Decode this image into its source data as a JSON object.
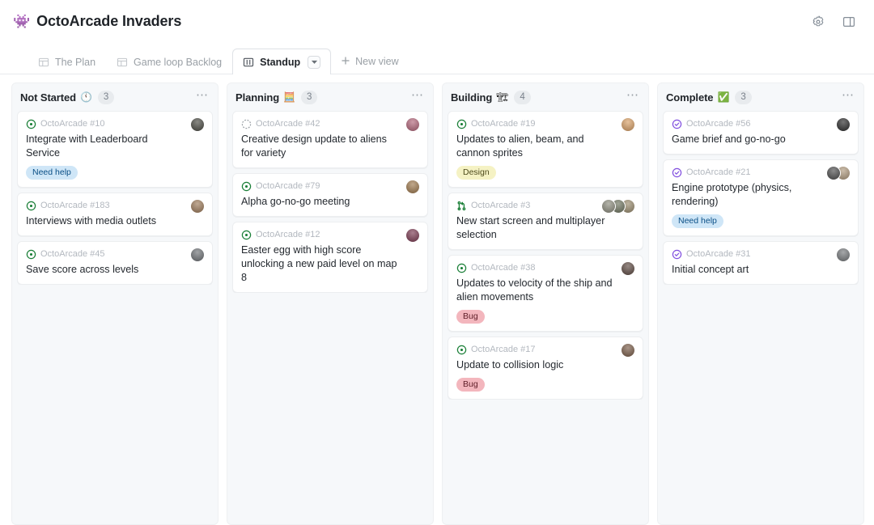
{
  "header": {
    "project_emoji": "👾",
    "title": "OctoArcade Invaders",
    "settings_icon": "gear-icon",
    "panel_icon": "side-panel-icon"
  },
  "tabs": [
    {
      "label": "The Plan",
      "icon": "table-icon",
      "active": false
    },
    {
      "label": "Game loop Backlog",
      "icon": "table-icon",
      "active": false
    },
    {
      "label": "Standup",
      "icon": "board-icon",
      "active": true
    }
  ],
  "new_view": {
    "label": "New view",
    "icon": "plus-icon"
  },
  "add_column": {
    "icon": "plus-icon"
  },
  "colors": {
    "need_help_bg": "#cfe6f7",
    "need_help_fg": "#0a4f86",
    "design_bg": "#f5f2c4",
    "design_fg": "#4e4b1c",
    "bug_bg": "#f3b6bd",
    "bug_fg": "#5e1e28",
    "open_issue": "#1a7f37",
    "closed_issue": "#8250df",
    "draft_issue": "#9aa0a6",
    "open_pr": "#1a7f37",
    "column_bg": "#f6f8fa"
  },
  "columns": [
    {
      "name": "Not Started",
      "emoji": "🕚",
      "count": "3",
      "more_icon": "kebab-icon",
      "cards": [
        {
          "ref": "OctoArcade #10",
          "state": "open-issue",
          "title": "Integrate with Leaderboard Service",
          "labels": [
            {
              "text": "Need help",
              "style": "need_help"
            }
          ],
          "avatars": [
            "#4a4a42"
          ]
        },
        {
          "ref": "OctoArcade #183",
          "state": "open-issue",
          "title": "Interviews with media outlets",
          "labels": [],
          "avatars": [
            "#9e7b5a"
          ]
        },
        {
          "ref": "OctoArcade #45",
          "state": "open-issue",
          "title": "Save score across levels",
          "labels": [],
          "avatars": [
            "#6e7276"
          ]
        }
      ]
    },
    {
      "name": "Planning",
      "emoji": "🧮",
      "count": "3",
      "more_icon": "kebab-icon",
      "cards": [
        {
          "ref": "OctoArcade #42",
          "state": "draft-issue",
          "title": "Creative design update to aliens for variety",
          "labels": [],
          "avatars": [
            "#b3657a"
          ]
        },
        {
          "ref": "OctoArcade #79",
          "state": "open-issue",
          "title": "Alpha go-no-go meeting",
          "labels": [],
          "avatars": [
            "#a07a4e"
          ]
        },
        {
          "ref": "OctoArcade #12",
          "state": "open-issue",
          "title": "Easter egg with high score unlocking a new paid level on map 8",
          "labels": [],
          "avatars": [
            "#7c3a52"
          ]
        }
      ]
    },
    {
      "name": "Building",
      "emoji": "🏗",
      "count": "4",
      "more_icon": "kebab-icon",
      "cards": [
        {
          "ref": "OctoArcade #19",
          "state": "open-issue",
          "title": "Updates to alien, beam, and cannon sprites",
          "labels": [
            {
              "text": "Design",
              "style": "design"
            }
          ],
          "avatars": [
            "#d9a066"
          ]
        },
        {
          "ref": "OctoArcade #3",
          "state": "open-pr",
          "title": "New start screen and multiplayer selection",
          "labels": [],
          "avatars": [
            "#8d8d7e",
            "#6f7560",
            "#9a8c6e"
          ]
        },
        {
          "ref": "OctoArcade #38",
          "state": "open-issue",
          "title": "Updates to velocity of the ship and alien movements",
          "labels": [
            {
              "text": "Bug",
              "style": "bug"
            }
          ],
          "avatars": [
            "#5e4a42"
          ]
        },
        {
          "ref": "OctoArcade #17",
          "state": "open-issue",
          "title": "Update to collision logic",
          "labels": [
            {
              "text": "Bug",
              "style": "bug"
            }
          ],
          "avatars": [
            "#7a5c48"
          ]
        }
      ]
    },
    {
      "name": "Complete",
      "emoji": "✅",
      "count": "3",
      "more_icon": "kebab-icon",
      "cards": [
        {
          "ref": "OctoArcade #56",
          "state": "closed-issue",
          "title": "Game brief and go-no-go",
          "labels": [],
          "avatars": [
            "#2b2b2b"
          ]
        },
        {
          "ref": "OctoArcade #21",
          "state": "closed-issue",
          "title": "Engine prototype (physics, rendering)",
          "labels": [
            {
              "text": "Need help",
              "style": "need_help"
            }
          ],
          "avatars": [
            "#4d4d4d",
            "#b09a7e"
          ]
        },
        {
          "ref": "OctoArcade #31",
          "state": "closed-issue",
          "title": "Initial concept art",
          "labels": [],
          "avatars": [
            "#76797c"
          ]
        }
      ]
    }
  ]
}
